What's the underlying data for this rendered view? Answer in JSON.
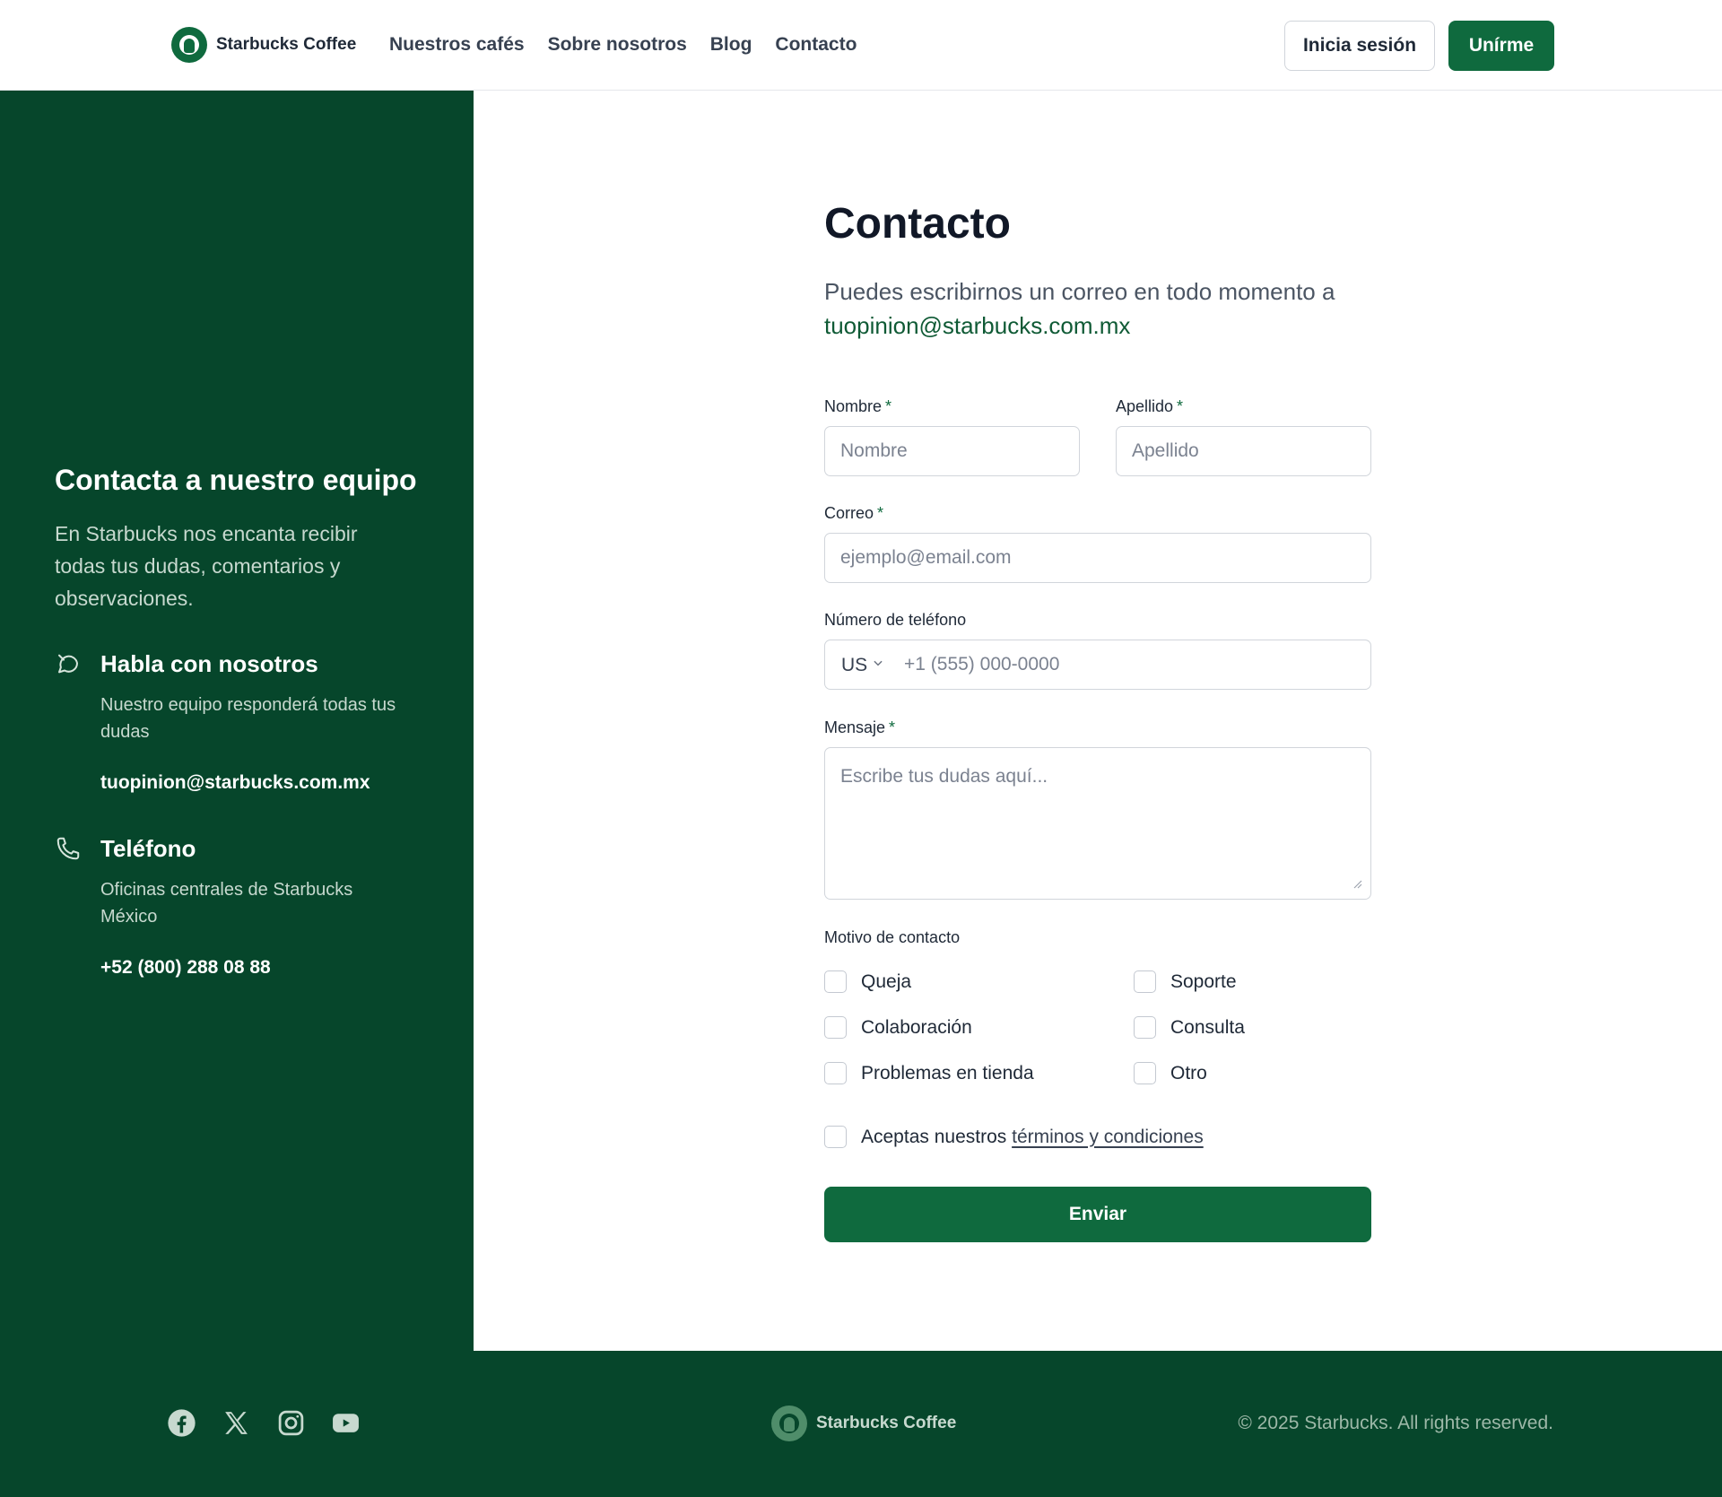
{
  "header": {
    "brand": "Starbucks Coffee",
    "nav": [
      "Nuestros cafés",
      "Sobre nosotros",
      "Blog",
      "Contacto"
    ],
    "login_label": "Inicia sesión",
    "join_label": "Unírme"
  },
  "side": {
    "title": "Contacta a nuestro equipo",
    "lead": "En Starbucks nos encanta recibir todas tus dudas, comentarios y observaciones.",
    "chat": {
      "title": "Habla con nosotros",
      "desc": "Nuestro equipo responderá todas tus dudas",
      "value": "tuopinion@starbucks.com.mx"
    },
    "phone": {
      "title": "Teléfono",
      "desc": "Oficinas centrales de Starbucks México",
      "value": "+52 (800) 288 08 88"
    }
  },
  "form": {
    "title": "Contacto",
    "intro": "Puedes escribirnos un correo en todo momento a",
    "intro_email": "tuopinion@starbucks.com.mx",
    "first_name": {
      "label": "Nombre",
      "placeholder": "Nombre",
      "required": "*"
    },
    "last_name": {
      "label": "Apellido",
      "placeholder": "Apellido",
      "required": "*"
    },
    "email": {
      "label": "Correo",
      "placeholder": "ejemplo@email.com",
      "required": "*"
    },
    "phone": {
      "label": "Número de teléfono",
      "country": "US",
      "placeholder": "+1 (555) 000-0000"
    },
    "message": {
      "label": "Mensaje",
      "placeholder": "Escribe tus dudas aquí...",
      "required": "*"
    },
    "reason_label": "Motivo de contacto",
    "reasons": [
      "Queja",
      "Soporte",
      "Colaboración",
      "Consulta",
      "Problemas en tienda",
      "Otro"
    ],
    "terms_prefix": "Aceptas nuestros",
    "terms_link": "términos y condiciones",
    "submit": "Enviar"
  },
  "footer": {
    "brand": "Starbucks Coffee",
    "copyright": "© 2025 Starbucks. All rights reserved.",
    "social_icons": [
      "facebook-icon",
      "x-icon",
      "instagram-icon",
      "youtube-icon"
    ]
  },
  "colors": {
    "brand_green": "#0f6a3e",
    "dark_green": "#06462b"
  }
}
